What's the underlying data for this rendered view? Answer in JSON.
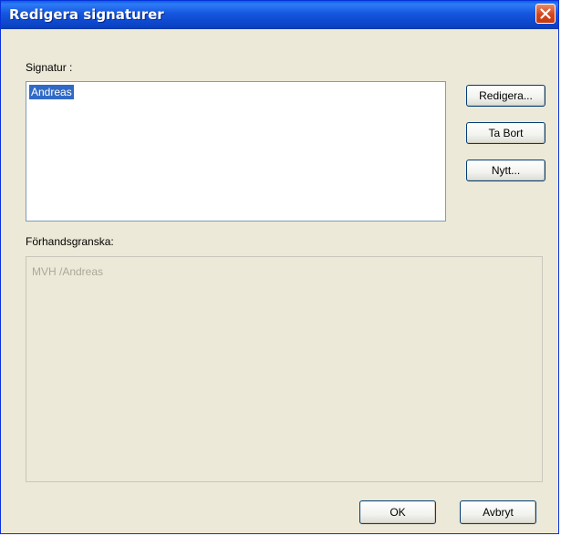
{
  "window": {
    "title": "Redigera signaturer"
  },
  "signatures": {
    "label": "Signatur :",
    "items": [
      "Andreas"
    ]
  },
  "buttons": {
    "edit": "Redigera...",
    "delete": "Ta Bort",
    "new": "Nytt...",
    "ok": "OK",
    "cancel": "Avbryt"
  },
  "preview": {
    "label": "Förhandsgranska:",
    "text": "MVH /Andreas"
  },
  "colors": {
    "titlebar": "#0b45c9",
    "selection": "#316ac5",
    "close": "#d2461c"
  }
}
